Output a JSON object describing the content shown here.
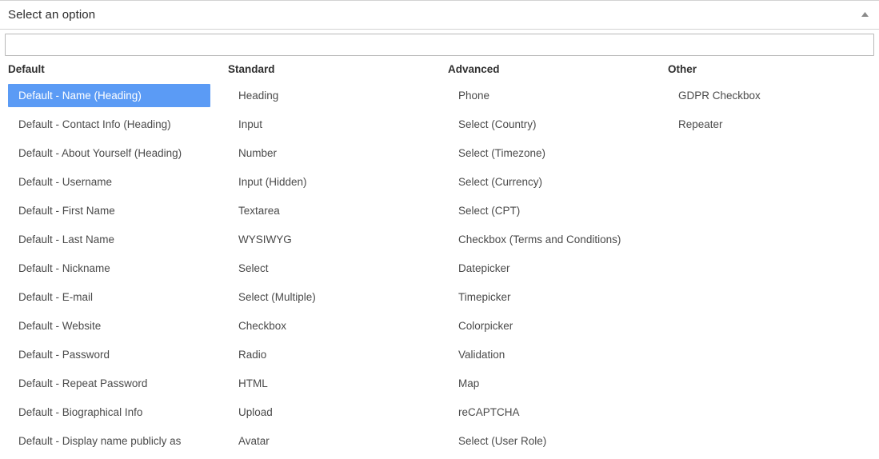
{
  "header": {
    "title": "Select an option",
    "collapse_icon": "chevron-up-icon"
  },
  "search": {
    "value": "",
    "placeholder": ""
  },
  "colors": {
    "selection_blue": "#5b9bf5",
    "text": "#4a4a4a",
    "header_text": "#2f2f2f",
    "border": "#d2d2d2"
  },
  "columns": [
    {
      "header": "Default",
      "items": [
        {
          "label": "Default - Name (Heading)",
          "selected": true
        },
        {
          "label": "Default - Contact Info (Heading)",
          "selected": false
        },
        {
          "label": "Default - About Yourself (Heading)",
          "selected": false
        },
        {
          "label": "Default - Username",
          "selected": false
        },
        {
          "label": "Default - First Name",
          "selected": false
        },
        {
          "label": "Default - Last Name",
          "selected": false
        },
        {
          "label": "Default - Nickname",
          "selected": false
        },
        {
          "label": "Default - E-mail",
          "selected": false
        },
        {
          "label": "Default - Website",
          "selected": false
        },
        {
          "label": "Default - Password",
          "selected": false
        },
        {
          "label": "Default - Repeat Password",
          "selected": false
        },
        {
          "label": "Default - Biographical Info",
          "selected": false
        },
        {
          "label": "Default - Display name publicly as",
          "selected": false
        }
      ]
    },
    {
      "header": "Standard",
      "items": [
        {
          "label": "Heading",
          "selected": false
        },
        {
          "label": "Input",
          "selected": false
        },
        {
          "label": "Number",
          "selected": false
        },
        {
          "label": "Input (Hidden)",
          "selected": false
        },
        {
          "label": "Textarea",
          "selected": false
        },
        {
          "label": "WYSIWYG",
          "selected": false
        },
        {
          "label": "Select",
          "selected": false
        },
        {
          "label": "Select (Multiple)",
          "selected": false
        },
        {
          "label": "Checkbox",
          "selected": false
        },
        {
          "label": "Radio",
          "selected": false
        },
        {
          "label": "HTML",
          "selected": false
        },
        {
          "label": "Upload",
          "selected": false
        },
        {
          "label": "Avatar",
          "selected": false
        }
      ]
    },
    {
      "header": "Advanced",
      "items": [
        {
          "label": "Phone",
          "selected": false
        },
        {
          "label": "Select (Country)",
          "selected": false
        },
        {
          "label": "Select (Timezone)",
          "selected": false
        },
        {
          "label": "Select (Currency)",
          "selected": false
        },
        {
          "label": "Select (CPT)",
          "selected": false
        },
        {
          "label": "Checkbox (Terms and Conditions)",
          "selected": false
        },
        {
          "label": "Datepicker",
          "selected": false
        },
        {
          "label": "Timepicker",
          "selected": false
        },
        {
          "label": "Colorpicker",
          "selected": false
        },
        {
          "label": "Validation",
          "selected": false
        },
        {
          "label": "Map",
          "selected": false
        },
        {
          "label": "reCAPTCHA",
          "selected": false
        },
        {
          "label": "Select (User Role)",
          "selected": false
        }
      ]
    },
    {
      "header": "Other",
      "items": [
        {
          "label": "GDPR Checkbox",
          "selected": false
        },
        {
          "label": "Repeater",
          "selected": false
        }
      ]
    }
  ]
}
